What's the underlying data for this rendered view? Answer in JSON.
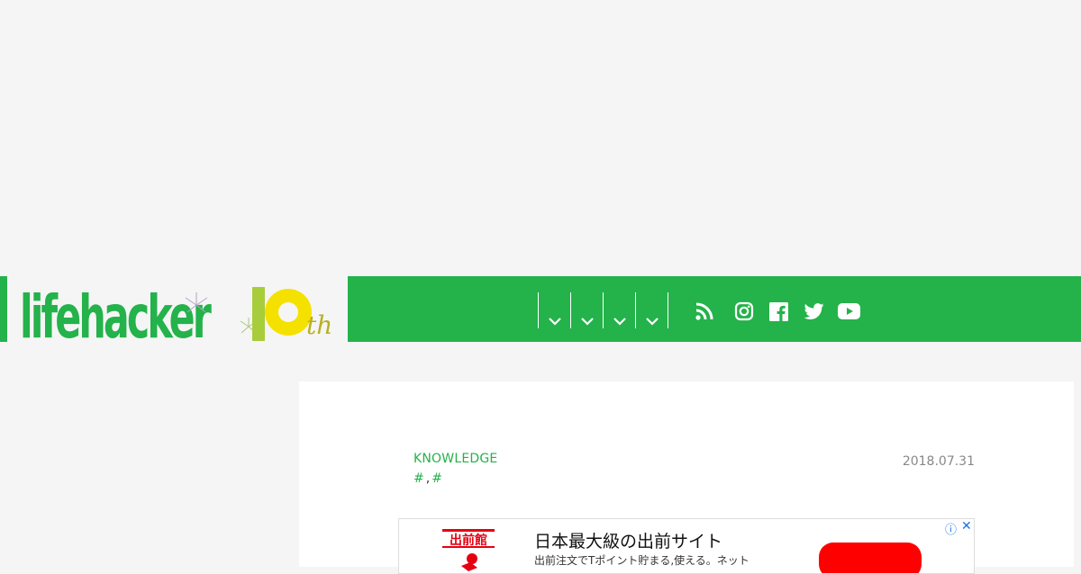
{
  "brand": {
    "name": "lifehacker",
    "badge": "10th",
    "accent": "#24b24a",
    "badge_color": "#f5e100"
  },
  "nav": {
    "items": [
      {
        "label": "",
        "icon": "chevron-down-icon"
      },
      {
        "label": "",
        "icon": "chevron-down-icon"
      },
      {
        "label": "",
        "icon": "chevron-down-icon"
      },
      {
        "label": "",
        "icon": "chevron-down-icon"
      }
    ],
    "social": [
      "rss-icon",
      "instagram-icon",
      "facebook-icon",
      "twitter-icon",
      "youtube-icon"
    ]
  },
  "article": {
    "category": "KNOWLEDGE",
    "tags": [
      "#",
      "#"
    ],
    "tag_separator": ",",
    "date": "2018.07.31"
  },
  "ad": {
    "title": "日本最大級の出前サイト",
    "description": "出前注文でTポイント貯まる,使える。ネット",
    "logo_text": "出前館",
    "info_icon": "ⓘ",
    "close_icon": "✕",
    "cta_color": "#ff0000"
  }
}
